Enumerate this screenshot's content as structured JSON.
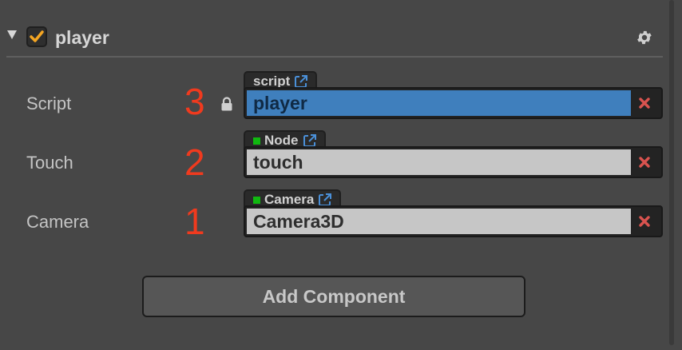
{
  "component": {
    "title": "player",
    "enabled": true,
    "accent_color": "#f5a623"
  },
  "properties": [
    {
      "label": "Script",
      "annotation": "3",
      "locked": true,
      "type_tag": "script",
      "type_dot": false,
      "value": "player",
      "selected": true
    },
    {
      "label": "Touch",
      "annotation": "2",
      "locked": false,
      "type_tag": "Node",
      "type_dot": true,
      "value": "touch",
      "selected": false
    },
    {
      "label": "Camera",
      "annotation": "1",
      "locked": false,
      "type_tag": "Camera",
      "type_dot": true,
      "value": "Camera3D",
      "selected": false
    }
  ],
  "colors": {
    "panel_bg": "#474747",
    "selected_field": "#3f7fbd",
    "annotation": "#f03a1e",
    "type_dot": "#10b810",
    "link_icon": "#4a90d9",
    "remove_icon": "#d9534f"
  },
  "icons": {
    "collapse": "triangle-down-icon",
    "settings": "gear-icon",
    "lock": "lock-icon",
    "link": "external-link-icon",
    "remove": "x-icon"
  },
  "add_component_label": "Add Component"
}
